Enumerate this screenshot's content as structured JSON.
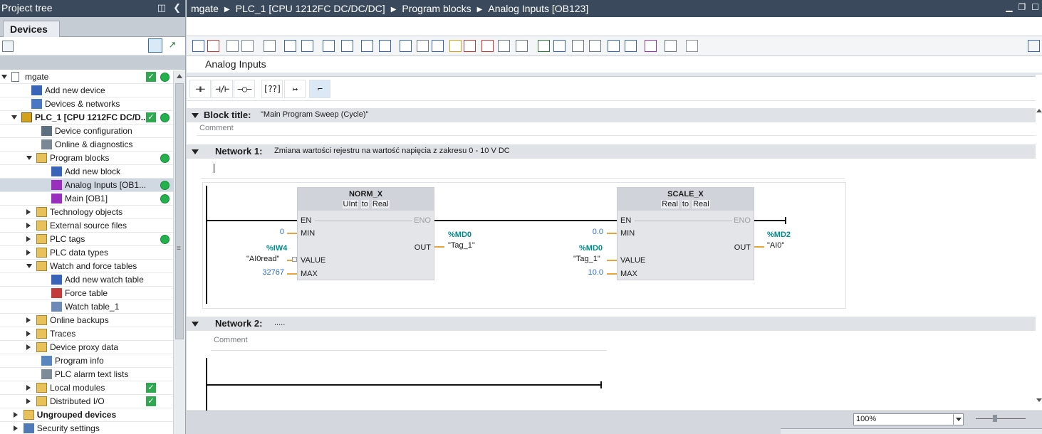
{
  "tree": {
    "title": "Project tree",
    "tab": "Devices",
    "items": [
      {
        "label": "mgate",
        "icon": "project-icon"
      },
      {
        "label": "Add new device",
        "icon": "add-device-icon"
      },
      {
        "label": "Devices & networks",
        "icon": "network-icon"
      },
      {
        "label": "PLC_1 [CPU 1212FC DC/D...",
        "icon": "plc-icon"
      },
      {
        "label": "Device configuration",
        "icon": "device-config-icon"
      },
      {
        "label": "Online & diagnostics",
        "icon": "diagnostics-icon"
      },
      {
        "label": "Program blocks",
        "icon": "folder-icon"
      },
      {
        "label": "Add new block",
        "icon": "add-block-icon"
      },
      {
        "label": "Analog Inputs [OB1...",
        "icon": "ob-block-icon"
      },
      {
        "label": "Main [OB1]",
        "icon": "ob-block-icon"
      },
      {
        "label": "Technology objects",
        "icon": "folder-icon"
      },
      {
        "label": "External source files",
        "icon": "folder-icon"
      },
      {
        "label": "PLC tags",
        "icon": "folder-icon"
      },
      {
        "label": "PLC data types",
        "icon": "folder-icon"
      },
      {
        "label": "Watch and force tables",
        "icon": "folder-icon"
      },
      {
        "label": "Add new watch table",
        "icon": "add-table-icon"
      },
      {
        "label": "Force table",
        "icon": "force-table-icon"
      },
      {
        "label": "Watch table_1",
        "icon": "watch-table-icon"
      },
      {
        "label": "Online backups",
        "icon": "folder-icon"
      },
      {
        "label": "Traces",
        "icon": "folder-icon"
      },
      {
        "label": "Device proxy data",
        "icon": "folder-icon"
      },
      {
        "label": "Program info",
        "icon": "program-info-icon"
      },
      {
        "label": "PLC alarm text lists",
        "icon": "alarm-list-icon"
      },
      {
        "label": "Local modules",
        "icon": "folder-icon"
      },
      {
        "label": "Distributed I/O",
        "icon": "folder-icon"
      },
      {
        "label": "Ungrouped devices",
        "icon": "folder-icon"
      },
      {
        "label": "Security settings",
        "icon": "security-icon"
      }
    ]
  },
  "editor": {
    "breadcrumb": [
      "mgate",
      "PLC_1 [CPU 1212FC DC/DC/DC]",
      "Program blocks",
      "Analog Inputs [OB123]"
    ],
    "block_name": "Analog Inputs",
    "block_title_label": "Block title:",
    "block_title_value": "\"Main Program Sweep (Cycle)\"",
    "comment_placeholder": "Comment",
    "network1": {
      "label": "Network 1:",
      "title": "Zmiana wartości rejestru na wartość napięcia z zakresu 0 - 10 V DC",
      "norm": {
        "name": "NORM_X",
        "type_from": "UInt",
        "to": "to",
        "type_to": "Real",
        "en": "EN",
        "eno": "ENO",
        "min": "MIN",
        "value": "VALUE",
        "max": "MAX",
        "out": "OUT",
        "min_const": "0",
        "value_addr": "%IW4",
        "value_name": "\"AI0read\"",
        "max_const": "32767",
        "out_addr": "%MD0",
        "out_name": "\"Tag_1\""
      },
      "scale": {
        "name": "SCALE_X",
        "type_from": "Real",
        "to": "to",
        "type_to": "Real",
        "en": "EN",
        "eno": "ENO",
        "min": "MIN",
        "value": "VALUE",
        "max": "MAX",
        "out": "OUT",
        "min_const": "0.0",
        "value_addr": "%MD0",
        "value_name": "\"Tag_1\"",
        "max_const": "10.0",
        "out_addr": "%MD2",
        "out_name": "\"AI0\""
      }
    },
    "network2": {
      "label": "Network 2:",
      "title": "....."
    },
    "zoom": "100%"
  },
  "colors": {
    "header_bg": "#3a4a5c",
    "status_ok": "#22b14c",
    "pin_stub": "#e8a33a",
    "address": "#008b8b",
    "constant": "#2f6ec7"
  }
}
